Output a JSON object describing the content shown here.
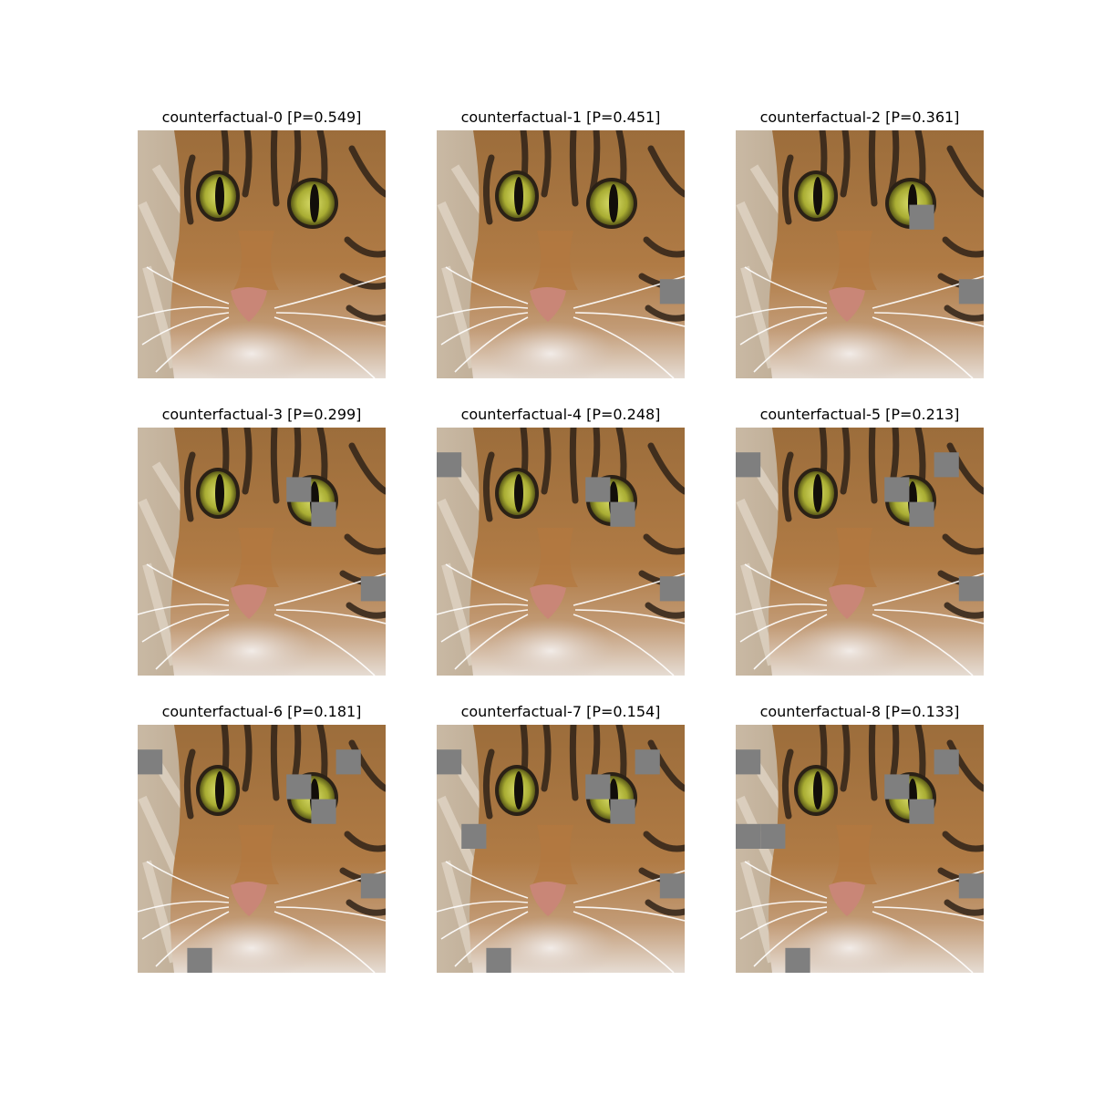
{
  "panels": [
    {
      "title": "counterfactual-0 [P=0.549]",
      "masks": []
    },
    {
      "title": "counterfactual-1 [P=0.451]",
      "masks": [
        [
          9,
          6
        ]
      ]
    },
    {
      "title": "counterfactual-2 [P=0.361]",
      "masks": [
        [
          9,
          6
        ],
        [
          7,
          3
        ]
      ]
    },
    {
      "title": "counterfactual-3 [P=0.299]",
      "masks": [
        [
          9,
          6
        ],
        [
          7,
          3
        ],
        [
          6,
          2
        ]
      ]
    },
    {
      "title": "counterfactual-4 [P=0.248]",
      "masks": [
        [
          9,
          6
        ],
        [
          7,
          3
        ],
        [
          6,
          2
        ],
        [
          0,
          1
        ]
      ]
    },
    {
      "title": "counterfactual-5 [P=0.213]",
      "masks": [
        [
          9,
          6
        ],
        [
          7,
          3
        ],
        [
          6,
          2
        ],
        [
          0,
          1
        ],
        [
          8,
          1
        ]
      ]
    },
    {
      "title": "counterfactual-6 [P=0.181]",
      "masks": [
        [
          9,
          6
        ],
        [
          7,
          3
        ],
        [
          6,
          2
        ],
        [
          0,
          1
        ],
        [
          8,
          1
        ],
        [
          2,
          9
        ]
      ]
    },
    {
      "title": "counterfactual-7 [P=0.154]",
      "masks": [
        [
          9,
          6
        ],
        [
          7,
          3
        ],
        [
          6,
          2
        ],
        [
          0,
          1
        ],
        [
          8,
          1
        ],
        [
          2,
          9
        ],
        [
          1,
          4
        ]
      ]
    },
    {
      "title": "counterfactual-8 [P=0.133]",
      "masks": [
        [
          9,
          6
        ],
        [
          7,
          3
        ],
        [
          6,
          2
        ],
        [
          0,
          1
        ],
        [
          8,
          1
        ],
        [
          2,
          9
        ],
        [
          1,
          4
        ],
        [
          0,
          4
        ]
      ]
    }
  ],
  "colors": {
    "mask": "#7f7f7f"
  },
  "grid": {
    "cols": 10,
    "rows": 10
  }
}
